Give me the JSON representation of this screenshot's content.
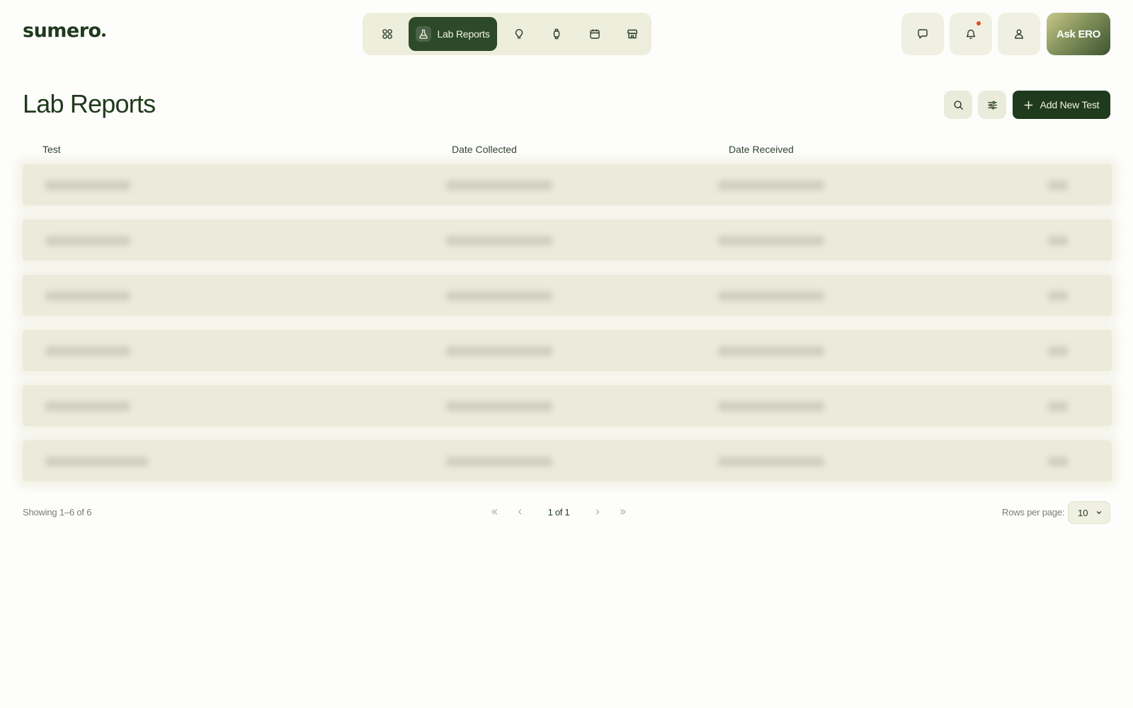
{
  "app": {
    "logo_text": "sumero"
  },
  "nav": {
    "items": [
      {
        "icon": "grid-icon",
        "label": ""
      },
      {
        "icon": "flask-icon",
        "label": "Lab Reports",
        "active": true
      },
      {
        "icon": "lightbulb-icon",
        "label": ""
      },
      {
        "icon": "watch-icon",
        "label": ""
      },
      {
        "icon": "calendar-icon",
        "label": ""
      },
      {
        "icon": "store-icon",
        "label": ""
      }
    ]
  },
  "header_actions": {
    "chat_icon": "chat-bubble-icon",
    "bell_icon": "bell-icon",
    "has_notification": true,
    "profile_icon": "user-icon",
    "ask_label": "Ask ERO"
  },
  "page": {
    "title": "Lab Reports",
    "add_button_label": "Add New Test",
    "search_icon": "search-icon",
    "filter_icon": "sliders-icon"
  },
  "table": {
    "columns": [
      "Test",
      "Date Collected",
      "Date Received"
    ],
    "row_count_shown": 6,
    "rows_blurred": true
  },
  "pagination": {
    "showing_text": "Showing 1–6 of 6",
    "page_label": "1 of 1",
    "rows_per_page_label": "Rows per page:",
    "rows_per_page_value": "10"
  },
  "colors": {
    "brand_dark": "#1f3a1c",
    "nav_bg": "#eeeedc",
    "nav_active": "#2d4a28",
    "row_bg": "#ebebdb",
    "notification": "#e2492f"
  }
}
